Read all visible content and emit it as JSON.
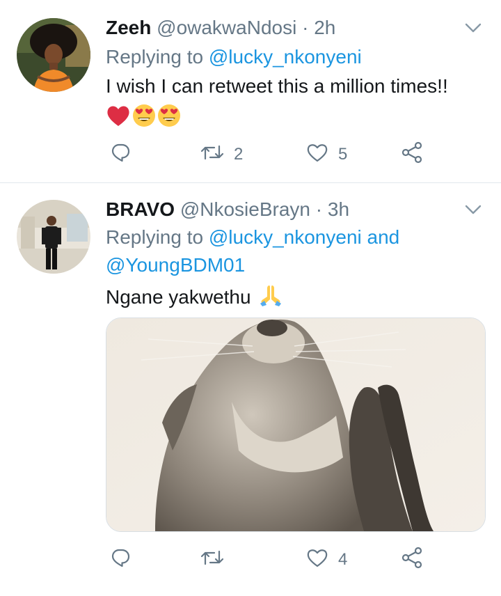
{
  "tweets": [
    {
      "display_name": "Zeeh",
      "handle": "@owakwaNdosi",
      "separator": "·",
      "time": "2h",
      "replying_prefix": "Replying to",
      "replying_mention": "@lucky_nkonyeni",
      "text": "I wish I can retweet this a million times!!",
      "emojis": [
        "red-heart",
        "heart-eyes",
        "heart-eyes"
      ],
      "replies": "",
      "retweets": "2",
      "likes": "5"
    },
    {
      "display_name": "BRAVO",
      "handle": "@NkosieBrayn",
      "separator": "·",
      "time": "3h",
      "replying_prefix": "Replying to",
      "replying_mention_1": "@lucky_nkonyeni",
      "replying_and": "and",
      "replying_mention_2": "@YoungBDM01",
      "text": "Ngane yakwethu",
      "emojis": [
        "folded-hands"
      ],
      "media": "praying otter photo",
      "replies": "",
      "retweets": "",
      "likes": "4"
    }
  ],
  "icons": {
    "reply": "reply-icon",
    "retweet": "retweet-icon",
    "like": "like-icon",
    "share": "share-icon",
    "caret": "chevron-down-icon"
  },
  "colors": {
    "link": "#1b95e0",
    "secondary": "#657786",
    "primary_text": "#14171a",
    "divider": "#e1e8ed"
  }
}
